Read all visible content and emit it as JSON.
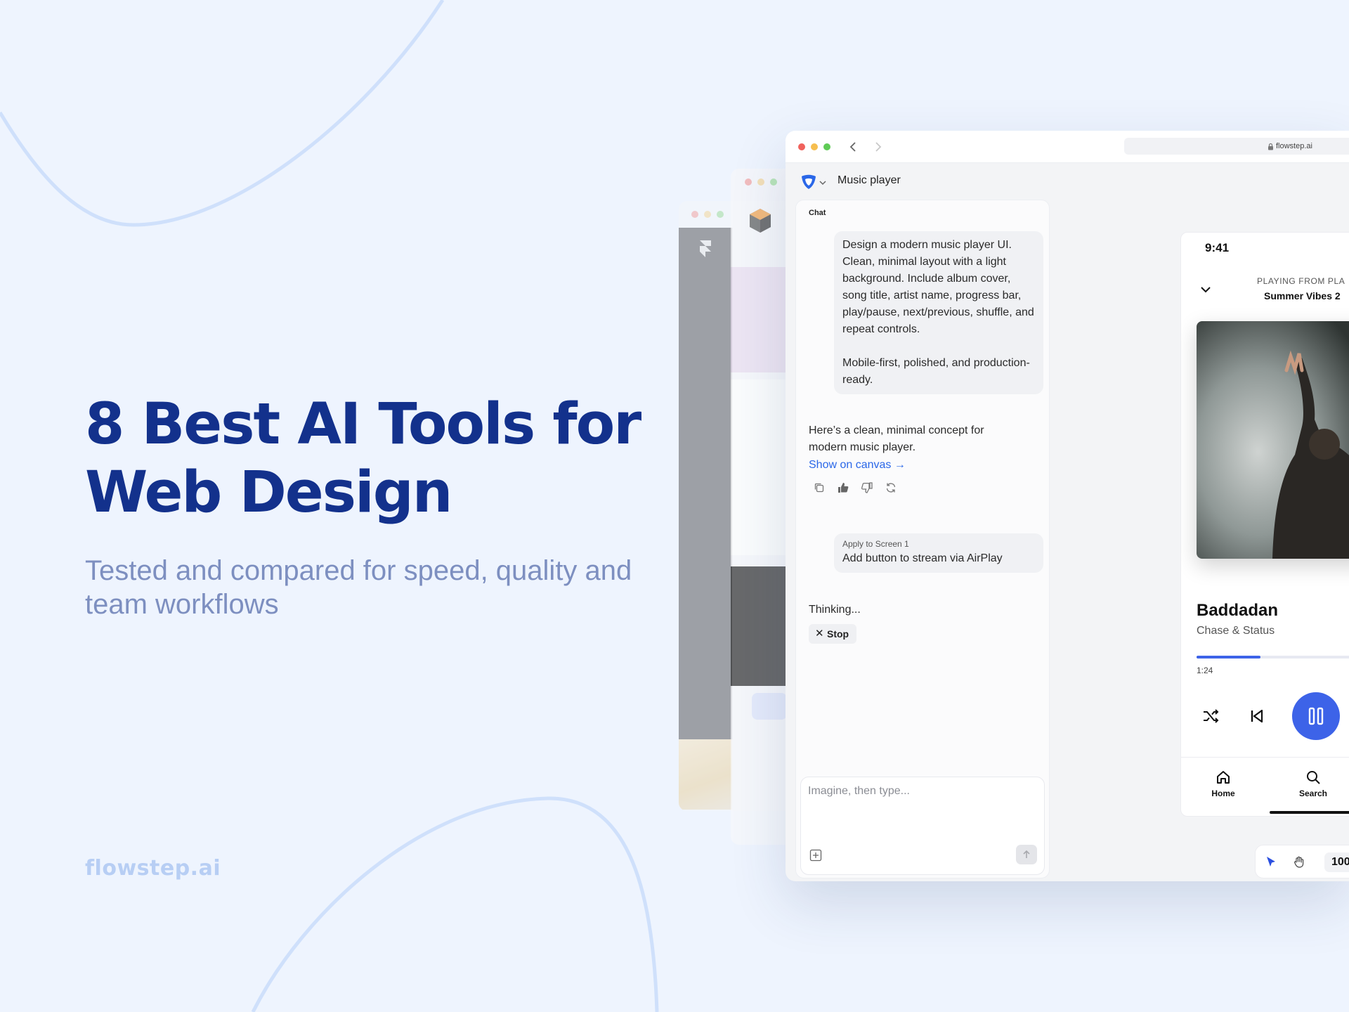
{
  "headline": {
    "line1": "8 Best AI Tools for",
    "line2": "Web Design"
  },
  "subheadline": "Tested and compared for speed, quality and team workflows",
  "brand": "flowstep.ai",
  "colors": {
    "headline": "#13318c",
    "subhead": "#7d8fc0",
    "accent": "#3d63e8",
    "background": "#eef4fe"
  },
  "window": {
    "url": "flowstep.ai",
    "project_title": "Music player",
    "icons": [
      "back-icon",
      "forward-icon",
      "lock-icon",
      "logo-icon",
      "chevron-down-icon"
    ]
  },
  "chat": {
    "label": "Chat",
    "user_message_1": {
      "para1": "Design a modern music player UI. Clean, minimal layout with a light background. Include album cover, song title, artist name, progress bar, play/pause, next/previous, shuffle, and repeat controls.",
      "para2": "Mobile-first, polished, and production-ready."
    },
    "assistant_message": "Here’s a clean, minimal concept for modern music player.",
    "show_on_canvas": "Show on canvas →",
    "action_icons": [
      "copy-icon",
      "thumbs-up-icon",
      "thumbs-down-icon",
      "refresh-icon"
    ],
    "user_message_2": {
      "context": "Apply to Screen 1",
      "text": "Add button to stream via AirPlay"
    },
    "status": "Thinking...",
    "stop_label": "Stop",
    "composer_placeholder": "Imagine, then type..."
  },
  "phone": {
    "time": "9:41",
    "playing_from": "PLAYING FROM PLA",
    "playlist": "Summer Vibes 2",
    "song_title": "Baddadan",
    "artist": "Chase & Status",
    "elapsed": "1:24",
    "progress": 0.35,
    "tabs": [
      {
        "label": "Home",
        "icon": "home-icon"
      },
      {
        "label": "Search",
        "icon": "search-icon"
      }
    ]
  },
  "canvas_toolbar": {
    "zoom": "100"
  }
}
